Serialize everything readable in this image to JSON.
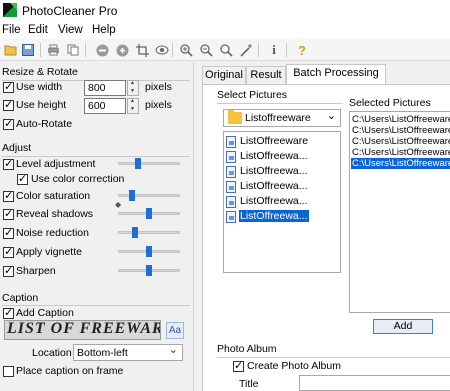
{
  "window": {
    "title": "PhotoCleaner Pro"
  },
  "menu": [
    "File",
    "Edit",
    "View",
    "Help"
  ],
  "toolbar_icons": [
    "open-icon",
    "save-icon",
    "print-icon",
    "copy-icon",
    "clear-icon",
    "revert-icon",
    "crop-icon",
    "redeye-icon",
    "zoom-in-icon",
    "zoom-out-icon",
    "magic-wand-icon",
    "auto-wand-icon",
    "info-icon",
    "help-icon"
  ],
  "resize": {
    "title": "Resize & Rotate",
    "use_width_label": "Use width",
    "use_width_value": "800",
    "use_height_label": "Use height",
    "use_height_value": "600",
    "units": "pixels",
    "auto_rotate_label": "Auto-Rotate"
  },
  "adjust": {
    "title": "Adjust",
    "level_adjustment": "Level adjustment",
    "use_color_correction": "Use color correction",
    "color_saturation": "Color saturation",
    "reveal_shadows": "Reveal shadows",
    "noise_reduction": "Noise reduction",
    "apply_vignette": "Apply vignette",
    "sharpen": "Sharpen",
    "slider_levels": {
      "level_adjustment": 0.3,
      "color_saturation": 0.2,
      "reveal_shadows": 0.5,
      "noise_reduction": 0.25,
      "apply_vignette": 0.5,
      "sharpen": 0.5
    }
  },
  "caption": {
    "title": "Caption",
    "add_caption_label": "Add Caption",
    "preview_text": "LIST OF FREEWAR",
    "font_button": "Aa",
    "location_label": "Location",
    "location_value": "Bottom-left",
    "place_on_frame_label": "Place caption on frame"
  },
  "tabs": [
    "Original",
    "Result",
    "Batch Processing"
  ],
  "batch": {
    "select_pictures_title": "Select Pictures",
    "folder_value": "Listoffreeware",
    "files": [
      "ListOffreeware",
      "ListOffreewa...",
      "ListOffreewa...",
      "ListOffreewa...",
      "ListOffreewa...",
      "ListOffreewa..."
    ],
    "selected_pictures_title": "Selected Pictures",
    "selected": [
      "C:\\Users\\ListOffreeware",
      "C:\\Users\\ListOffreeware",
      "C:\\Users\\ListOffreeware",
      "C:\\Users\\ListOffreeware",
      "C:\\Users\\ListOffreeware"
    ],
    "add_button": "Add"
  },
  "photo_album": {
    "title": "Photo Album",
    "create_label": "Create Photo Album",
    "title_label": "Title"
  },
  "colors": {
    "selection": "#0a64d6",
    "slider_thumb": "#1f6fd6",
    "folder": "#f5c13f"
  }
}
